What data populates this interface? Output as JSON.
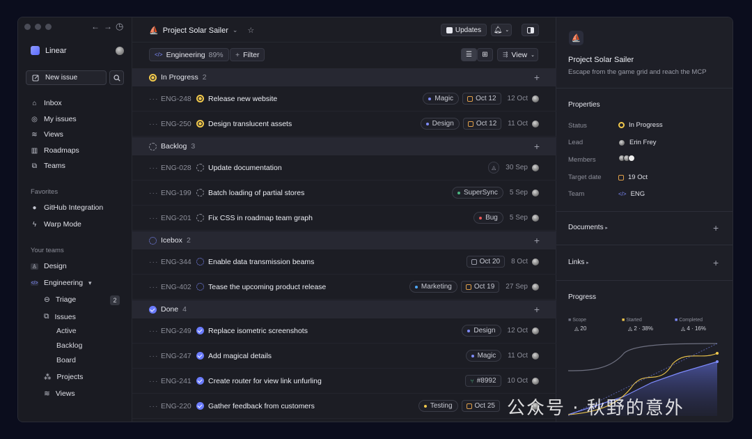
{
  "nav": {
    "back": "←",
    "forward": "→",
    "history": "◷"
  },
  "workspace": {
    "name": "Linear"
  },
  "sidebar": {
    "new_issue": "New issue",
    "items": [
      {
        "label": "Inbox",
        "icon": "inbox-icon"
      },
      {
        "label": "My issues",
        "icon": "my-issues-icon"
      },
      {
        "label": "Views",
        "icon": "views-icon"
      },
      {
        "label": "Roadmaps",
        "icon": "roadmaps-icon"
      },
      {
        "label": "Teams",
        "icon": "teams-icon"
      }
    ],
    "favorites_title": "Favorites",
    "favorites": [
      {
        "label": "GitHub Integration",
        "icon": "github-icon"
      },
      {
        "label": "Warp Mode",
        "icon": "bolt-icon"
      }
    ],
    "teams_title": "Your teams",
    "teams": [
      {
        "label": "Design",
        "icon": "design-icon"
      },
      {
        "label": "Engineering",
        "icon": "code-icon",
        "caret": "▾"
      }
    ],
    "eng_items": [
      {
        "label": "Triage",
        "count": "2"
      },
      {
        "label": "Issues"
      },
      {
        "label": "Projects"
      },
      {
        "label": "Views"
      }
    ],
    "issue_views": [
      "Active",
      "Backlog",
      "Board"
    ]
  },
  "topbar": {
    "project": "Project Solar Sailer",
    "updates": "Updates"
  },
  "filterbar": {
    "team": "Engineering",
    "team_pct": "89%",
    "filter": "Filter",
    "view": "View"
  },
  "groups": [
    {
      "name": "In Progress",
      "count": "2",
      "status": "progress"
    },
    {
      "name": "Backlog",
      "count": "3",
      "status": "backlog"
    },
    {
      "name": "Icebox",
      "count": "2",
      "status": "icebox"
    },
    {
      "name": "Done",
      "count": "4",
      "status": "done"
    }
  ],
  "issues": [
    {
      "id": "ENG-248",
      "title": "Release new website",
      "label": "Magic",
      "label_color": "#7f8cff",
      "due": "Oct 12",
      "date": "12 Oct"
    },
    {
      "id": "ENG-250",
      "title": "Design translucent assets",
      "label": "Design",
      "label_color": "#7f8cff",
      "due": "Oct 12",
      "date": "11 Oct"
    },
    {
      "id": "ENG-028",
      "title": "Update documentation",
      "date": "30 Sep"
    },
    {
      "id": "ENG-199",
      "title": "Batch loading of partial stores",
      "label": "SuperSync",
      "label_color": "#4cb782",
      "date": "5 Sep"
    },
    {
      "id": "ENG-201",
      "title": "Fix CSS in roadmap team graph",
      "label": "Bug",
      "label_color": "#eb5757",
      "date": "5 Sep"
    },
    {
      "id": "ENG-344",
      "title": "Enable data transmission beams",
      "due": "Oct 20",
      "date": "8 Oct"
    },
    {
      "id": "ENG-402",
      "title": "Tease the upcoming product release",
      "label": "Marketing",
      "label_color": "#4ea7fc",
      "due": "Oct 19",
      "date": "27 Sep"
    },
    {
      "id": "ENG-249",
      "title": "Replace isometric screenshots",
      "label": "Design",
      "label_color": "#7f8cff",
      "date": "12 Oct"
    },
    {
      "id": "ENG-247",
      "title": "Add magical details",
      "label": "Magic",
      "label_color": "#7f8cff",
      "date": "11 Oct"
    },
    {
      "id": "ENG-241",
      "title": "Create router for view link unfurling",
      "pr": "#8992",
      "date": "10 Oct"
    },
    {
      "id": "ENG-220",
      "title": "Gather feedback from customers",
      "label": "Testing",
      "label_color": "#f2c94c",
      "due": "Oct 25"
    }
  ],
  "panel": {
    "title": "Project Solar Sailer",
    "description": "Escape from the game grid and reach the MCP",
    "properties_title": "Properties",
    "status_label": "Status",
    "status": "In Progress",
    "lead_label": "Lead",
    "lead": "Erin Frey",
    "members_label": "Members",
    "target_label": "Target date",
    "target": "19 Oct",
    "team_label": "Team",
    "team": "ENG",
    "documents": "Documents",
    "links": "Links",
    "progress_title": "Progress"
  },
  "chart_data": {
    "type": "area",
    "series": [
      {
        "name": "Scope",
        "value": "20",
        "color": "#6e7080"
      },
      {
        "name": "Started",
        "value": "2",
        "pct": "38%",
        "color": "#f2c94c"
      },
      {
        "name": "Completed",
        "value": "4",
        "pct": "16%",
        "color": "#7f8cff"
      }
    ]
  },
  "watermark": "公众号 · 秋野的意外"
}
